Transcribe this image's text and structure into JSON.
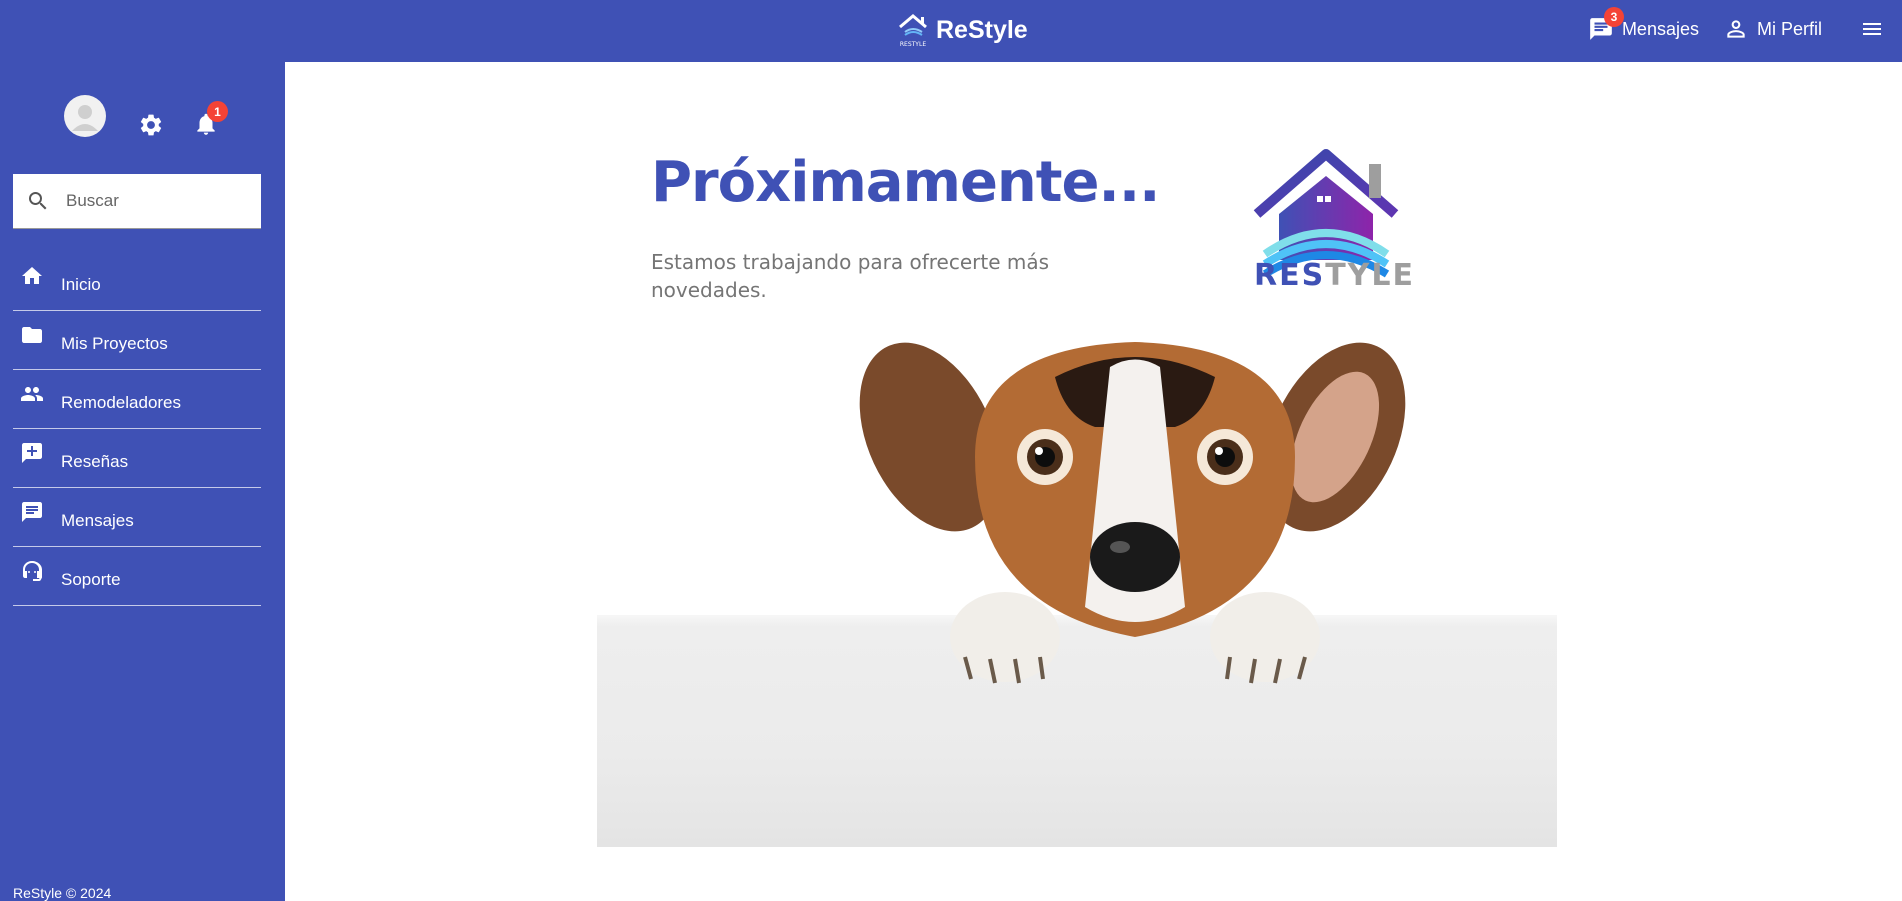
{
  "topbar": {
    "brand": "ReStyle",
    "brand_logo_text": "RESTYLE",
    "messages_label": "Mensajes",
    "messages_badge": "3",
    "profile_label": "Mi Perfil",
    "icons": [
      "chat-icon",
      "person-icon",
      "menu-icon"
    ]
  },
  "sidebar": {
    "notifications_badge": "1",
    "search": {
      "placeholder": "Buscar",
      "value": ""
    },
    "items": [
      {
        "label": "Inicio",
        "icon": "home-icon"
      },
      {
        "label": "Mis Proyectos",
        "icon": "folder-icon"
      },
      {
        "label": "Remodeladores",
        "icon": "people-icon"
      },
      {
        "label": "Reseñas",
        "icon": "rate-review-icon"
      },
      {
        "label": "Mensajes",
        "icon": "chat-icon"
      },
      {
        "label": "Soporte",
        "icon": "support-agent-icon"
      }
    ],
    "footer": "ReStyle © 2024"
  },
  "main": {
    "heading": "Próximamente...",
    "subtext": "Estamos trabajando para ofrecerte más novedades.",
    "logo": {
      "part1": "RES",
      "part2": "TYLE"
    }
  },
  "colors": {
    "primary": "#3f51b5",
    "badge": "#f44336",
    "subtext": "#757575",
    "logo_grey": "#9e9e9e"
  }
}
